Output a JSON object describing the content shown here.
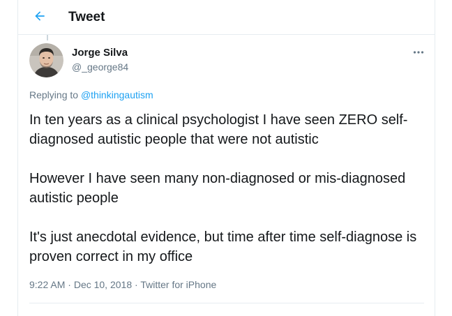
{
  "header": {
    "title": "Tweet",
    "back_icon": "arrow-left-icon",
    "accent_color": "#1da1f2"
  },
  "author": {
    "name": "Jorge Silva",
    "handle": "@_george84",
    "avatar": "profile-photo"
  },
  "reply": {
    "prefix": "Replying to ",
    "mention": "@thinkingautism"
  },
  "tweet": {
    "paragraphs": [
      "In ten years as a clinical psychologist I have seen ZERO self-diagnosed autistic people that were not autistic",
      "However I have seen many non-diagnosed or mis-diagnosed autistic people",
      "It's just anecdotal evidence, but time after time self-diagnose is proven correct in my office"
    ],
    "time": "9:22 AM",
    "separator1": " · ",
    "date": "Dec 10, 2018",
    "separator2": " · ",
    "source": "Twitter for iPhone"
  },
  "more_icon": "ellipsis-icon"
}
